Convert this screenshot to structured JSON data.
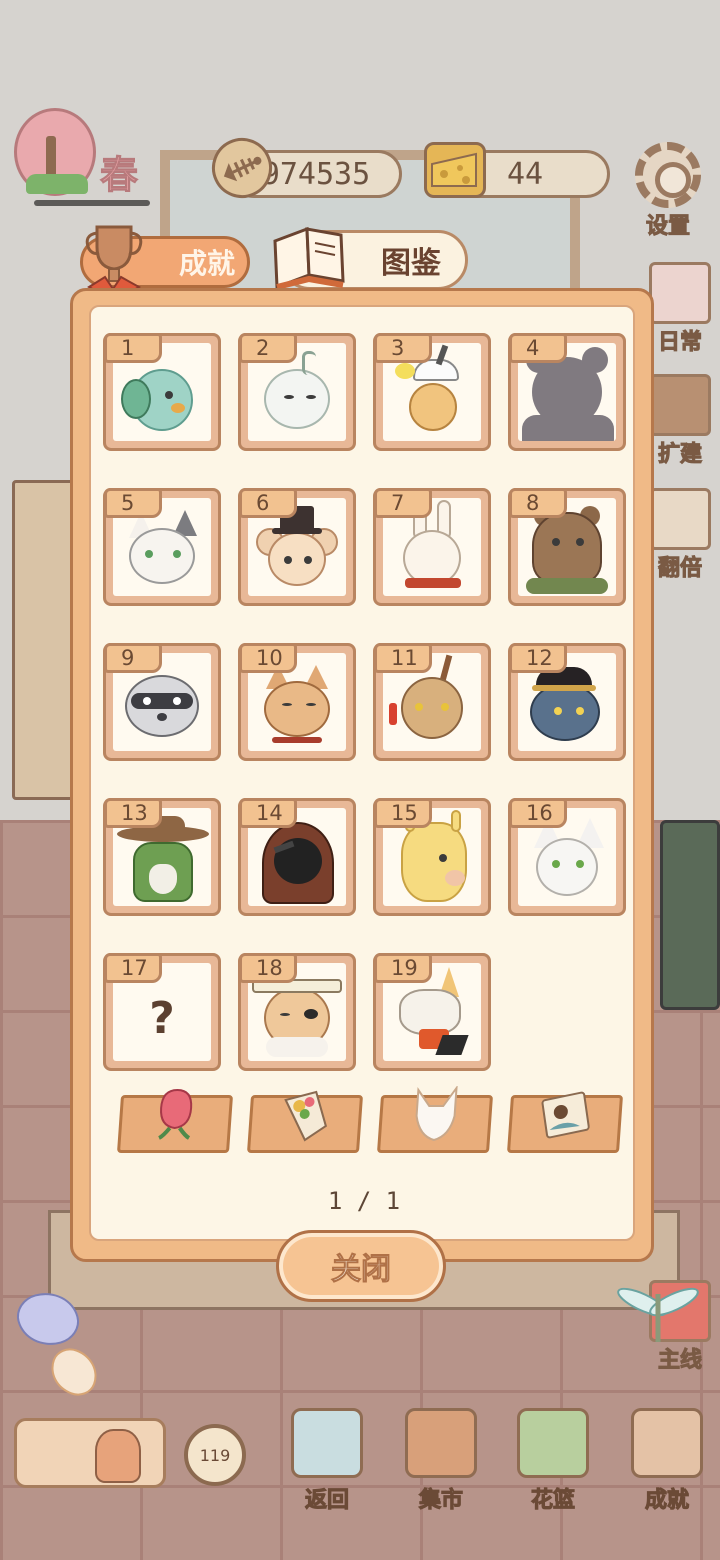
{
  "hud": {
    "season": "春",
    "fish_count": "974535",
    "cheese_count": "44",
    "settings_label": "设置"
  },
  "side_menu": [
    {
      "label": "日常"
    },
    {
      "label": "扩建"
    },
    {
      "label": "翻倍"
    },
    {
      "label": "主线"
    }
  ],
  "tabs": {
    "achievements": "成就",
    "collection": "图鉴"
  },
  "collection": {
    "cards": [
      {
        "num": "1",
        "animal": "peacock"
      },
      {
        "num": "2",
        "animal": "white-dragon"
      },
      {
        "num": "3",
        "animal": "unicorn-deer"
      },
      {
        "num": "4",
        "animal": "locked-bear-silhouette"
      },
      {
        "num": "5",
        "animal": "calico-cat"
      },
      {
        "num": "6",
        "animal": "mouse-top-hat"
      },
      {
        "num": "7",
        "animal": "white-rabbit"
      },
      {
        "num": "8",
        "animal": "brown-bear"
      },
      {
        "num": "9",
        "animal": "raccoon"
      },
      {
        "num": "10",
        "animal": "shiba-dog"
      },
      {
        "num": "11",
        "animal": "deer"
      },
      {
        "num": "12",
        "animal": "wolf-captain"
      },
      {
        "num": "13",
        "animal": "cactus-cowboy"
      },
      {
        "num": "14",
        "animal": "crow-hooded"
      },
      {
        "num": "15",
        "animal": "alpaca"
      },
      {
        "num": "16",
        "animal": "white-fox"
      },
      {
        "num": "17",
        "animal": "unknown",
        "mystery": "?"
      },
      {
        "num": "18",
        "animal": "shiba-samurai"
      },
      {
        "num": "19",
        "animal": "bandaged-fox"
      }
    ],
    "items": [
      "rose-icon",
      "bouquet-icon",
      "fox-silhouette-icon",
      "photo-card-icon"
    ],
    "page": "1 / 1",
    "close_label": "关闭"
  },
  "bottom_nav": {
    "clock_value": "119",
    "items": [
      {
        "label": "返回",
        "icon": "window-icon"
      },
      {
        "label": "集市",
        "icon": "market-stall-icon"
      },
      {
        "label": "花篮",
        "icon": "flower-basket-icon"
      },
      {
        "label": "成就",
        "icon": "trophy-icon"
      }
    ]
  },
  "colors": {
    "panel": "#f0ba87",
    "panel_inner": "#fdf6e6",
    "card": "#e8b897",
    "accent": "#b6784c"
  }
}
